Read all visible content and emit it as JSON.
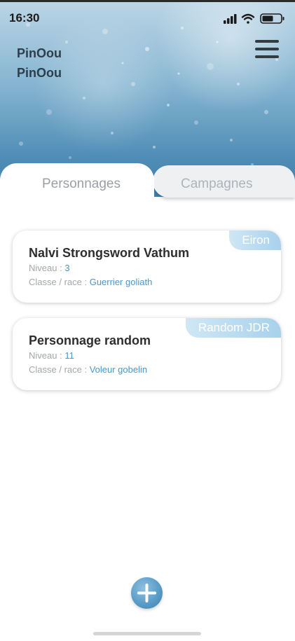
{
  "status_bar": {
    "time": "16:30"
  },
  "header": {
    "user_name_line1": "PinOou",
    "user_name_line2": "PinOou"
  },
  "tabs": [
    {
      "label": "Personnages",
      "active": true
    },
    {
      "label": "Campagnes",
      "active": false
    }
  ],
  "characters": [
    {
      "name": "Nalvi Strongsword Vathum",
      "campaign": "Eiron",
      "level_label": "Niveau : ",
      "level": "3",
      "class_label": "Classe / race : ",
      "class_race": "Guerrier goliath"
    },
    {
      "name": "Personnage random",
      "campaign": "Random JDR",
      "level_label": "Niveau : ",
      "level": "11",
      "class_label": "Classe / race : ",
      "class_race": "Voleur gobelin"
    }
  ],
  "icons": {
    "signal": "cellular-signal-icon",
    "wifi": "wifi-icon",
    "battery": "battery-icon",
    "menu": "hamburger-menu-icon",
    "add": "plus-icon"
  },
  "colors": {
    "accent": "#4e95c7",
    "badge": "#a8d1ec",
    "title": "#2e2e2e",
    "muted": "#a3a7ab"
  }
}
